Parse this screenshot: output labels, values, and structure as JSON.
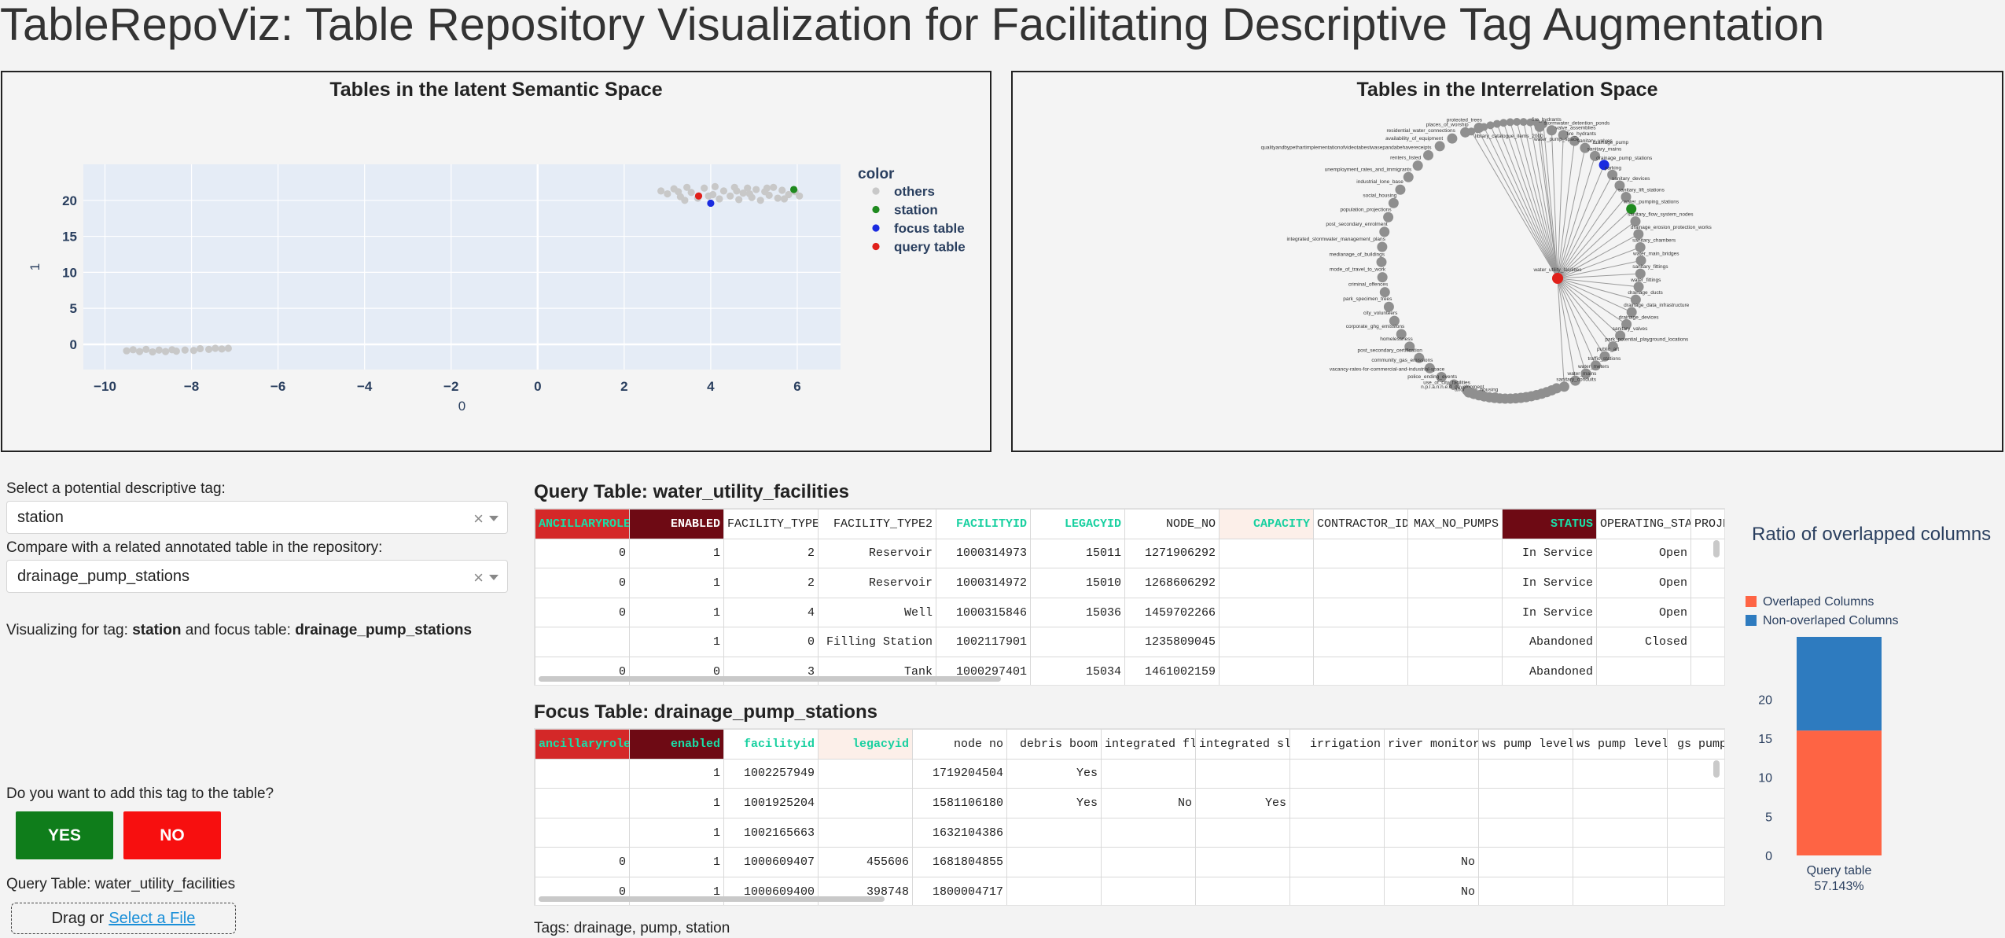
{
  "app": {
    "title": "TableRepoViz: Table Repository Visualization for Facilitating Descriptive Tag Augmentation"
  },
  "semantic_panel": {
    "title": "Tables in the latent Semantic Space",
    "chart_data": {
      "type": "scatter",
      "title": "Tables in the latent Semantic Space",
      "xlabel": "0",
      "ylabel": "1",
      "xlim": [
        -10.5,
        7
      ],
      "ylim": [
        -3.5,
        25
      ],
      "xticks": [
        -10,
        -8,
        -6,
        -4,
        -2,
        0,
        2,
        4,
        6
      ],
      "yticks": [
        0,
        5,
        10,
        15,
        20
      ],
      "grid": true,
      "legend_title": "color",
      "legend_placement": "right",
      "series": [
        {
          "name": "others",
          "color": "#c8c8c8",
          "points": [
            [
              -9.5,
              -0.9
            ],
            [
              -9.35,
              -0.75
            ],
            [
              -9.2,
              -1.0
            ],
            [
              -9.05,
              -0.7
            ],
            [
              -8.9,
              -1.05
            ],
            [
              -8.75,
              -0.8
            ],
            [
              -8.6,
              -1.0
            ],
            [
              -8.45,
              -0.75
            ],
            [
              -8.35,
              -0.95
            ],
            [
              -8.15,
              -0.8
            ],
            [
              -7.95,
              -0.85
            ],
            [
              -7.8,
              -0.6
            ],
            [
              -7.6,
              -0.7
            ],
            [
              -7.45,
              -0.55
            ],
            [
              -7.3,
              -0.65
            ],
            [
              -7.15,
              -0.55
            ],
            [
              2.85,
              21.3
            ],
            [
              3.0,
              20.9
            ],
            [
              3.15,
              21.6
            ],
            [
              3.3,
              20.5
            ],
            [
              3.45,
              21.8
            ],
            [
              3.55,
              21.1
            ],
            [
              3.7,
              20.3
            ],
            [
              3.85,
              21.7
            ],
            [
              3.95,
              20.6
            ],
            [
              4.1,
              21.9
            ],
            [
              4.2,
              20.2
            ],
            [
              4.3,
              21.3
            ],
            [
              4.45,
              20.6
            ],
            [
              4.55,
              21.8
            ],
            [
              4.65,
              20.1
            ],
            [
              4.75,
              21.0
            ],
            [
              4.85,
              21.7
            ],
            [
              4.95,
              20.4
            ],
            [
              5.05,
              21.5
            ],
            [
              5.15,
              20.0
            ],
            [
              5.25,
              21.2
            ],
            [
              5.35,
              20.7
            ],
            [
              5.45,
              21.8
            ],
            [
              5.55,
              20.3
            ],
            [
              5.65,
              21.4
            ],
            [
              5.8,
              20.8
            ],
            [
              5.95,
              21.2
            ],
            [
              3.4,
              20.0
            ],
            [
              4.05,
              20.8
            ],
            [
              4.9,
              20.9
            ],
            [
              5.3,
              21.7
            ],
            [
              3.25,
              21.2
            ],
            [
              4.6,
              21.3
            ],
            [
              5.7,
              20.2
            ],
            [
              6.05,
              20.6
            ]
          ]
        },
        {
          "name": "station",
          "color": "#1f8a1f",
          "points": [
            [
              5.92,
              21.5
            ]
          ]
        },
        {
          "name": "focus table",
          "color": "#1a2be0",
          "points": [
            [
              4.0,
              19.6
            ]
          ]
        },
        {
          "name": "query table",
          "color": "#e0201a",
          "points": [
            [
              3.72,
              20.6
            ]
          ]
        }
      ]
    }
  },
  "interrelation_panel": {
    "title": "Tables in the Interrelation Space",
    "labels_left": [
      "protected_trees",
      "places_of_worship",
      "residential_water_connections",
      "availability_of_equipment",
      "qualityandbypethartimplementationofvideotabestwasepandabehavereceipts",
      "renters_listed",
      "unemployment_rates_and_immigrants",
      "industrial_lone_base",
      "social_housing",
      "population_projections",
      "post_secondary_enrolment",
      "integrated_stormwater_management_plans",
      "medianage_of_buildings",
      "mode_of_travel_to_work",
      "criminal_offences",
      "park_specimen_trees",
      "city_volunteers",
      "corporate_ghg_emissions",
      "homelessness",
      "post_secondary_certification",
      "community_gas_emissions",
      "vacancy-rates-for-commercial-and-industrial-space",
      "police_ending_events",
      "use_of_city_facilities",
      "n.p.l.a.n.n.e.d_development",
      "affordable_housing"
    ],
    "labels_right": [
      "fire_hydrants",
      "stormwater_detention_ponds",
      "valve_assemblies",
      "fire_hydrants",
      "sanitary_valves",
      "sanitary_mains",
      "drainage_pump_stations",
      "parking",
      "sanitary_devices",
      "sanitary_lift_stations",
      "water_pumping_stations",
      "sanitary_flow_system_nodes",
      "drainage_erosion_protection_works",
      "sanitary_chambers",
      "water_main_bridges",
      "sanitary_fittings",
      "water_fittings",
      "drainage_ducts",
      "drainage_data_infrastructure",
      "drainage_devices",
      "sanitary_valves",
      "park_potential_playground_locations",
      "public_art",
      "traffic_stations",
      "water_meters",
      "water_mains",
      "sanitary_conduits"
    ],
    "labels_top": [
      "library_catalogue_items_2000",
      "water_pump_space",
      "drainage_pump"
    ],
    "query_label": "water_utility_facilities"
  },
  "controls": {
    "tag_prompt": "Select a potential descriptive tag:",
    "tag_value": "station",
    "compare_prompt": "Compare with a related annotated table in the repository:",
    "compare_value": "drainage_pump_stations",
    "clear_symbol": "×",
    "status_prefix": "Visualizing for tag: ",
    "status_tag": "station",
    "status_middle": " and focus table: ",
    "status_table": "drainage_pump_stations",
    "add_prompt": "Do you want to add this tag to the table?",
    "yes_label": "YES",
    "no_label": "NO",
    "query_table_line": "Query Table: water_utility_facilities",
    "upload_text": "Drag or",
    "upload_link": "Select a File",
    "colors": {
      "yes": "#0f7d1b",
      "no": "#f70f0f"
    }
  },
  "query_table": {
    "title": "Query Table: water_utility_facilities",
    "columns": [
      {
        "name": "ANCILLARYROLE",
        "bg": "#d42828",
        "fg": "#18e0a8",
        "cell": "#ffffff"
      },
      {
        "name": "ENABLED",
        "bg": "#6e0a14",
        "fg": "#ffffff",
        "cell": "#ffffff"
      },
      {
        "name": "FACILITY_TYPE",
        "bg": "#ffffff",
        "fg": "#222222",
        "cell": "#ffffff"
      },
      {
        "name": "FACILITY_TYPE2",
        "bg": "#ffffff",
        "fg": "#222222",
        "cell": "#ffffff"
      },
      {
        "name": "FACILITYID",
        "bg": "#ffffff",
        "fg": "#18d0a0",
        "cell": "#ffffff"
      },
      {
        "name": "LEGACYID",
        "bg": "#ffffff",
        "fg": "#18d0a0",
        "cell": "#ffffff"
      },
      {
        "name": "NODE_NO",
        "bg": "#ffffff",
        "fg": "#222222",
        "cell": "#ffffff"
      },
      {
        "name": "CAPACITY",
        "bg": "#fcefe9",
        "fg": "#18d0a0",
        "cell": "#ffffff"
      },
      {
        "name": "CONTRACTOR_ID",
        "bg": "#ffffff",
        "fg": "#222222",
        "cell": "#ffffff"
      },
      {
        "name": "MAX_NO_PUMPS",
        "bg": "#ffffff",
        "fg": "#222222",
        "cell": "#ffffff"
      },
      {
        "name": "STATUS",
        "bg": "#6e0a14",
        "fg": "#18e0a8",
        "cell": "#ffffff"
      },
      {
        "name": "OPERATING_STATUS",
        "bg": "#ffffff",
        "fg": "#222222",
        "cell": "#ffffff"
      },
      {
        "name": "PROJECT",
        "bg": "#ffffff",
        "fg": "#222222",
        "cell": "#ffffff"
      }
    ],
    "rows": [
      [
        "0",
        "1",
        "2",
        "Reservoir",
        "1000314973",
        "15011",
        "1271906292",
        "",
        "",
        "",
        "In Service",
        "Open",
        ""
      ],
      [
        "0",
        "1",
        "2",
        "Reservoir",
        "1000314972",
        "15010",
        "1268606292",
        "",
        "",
        "",
        "In Service",
        "Open",
        ""
      ],
      [
        "0",
        "1",
        "4",
        "Well",
        "1000315846",
        "15036",
        "1459702266",
        "",
        "",
        "",
        "In Service",
        "Open",
        ""
      ],
      [
        "",
        "1",
        "0",
        "Filling Station",
        "1002117901",
        "",
        "1235809045",
        "",
        "",
        "",
        "Abandoned",
        "Closed",
        ""
      ],
      [
        "0",
        "0",
        "3",
        "Tank",
        "1000297401",
        "15034",
        "1461002159",
        "",
        "",
        "",
        "Abandoned",
        "",
        ""
      ]
    ]
  },
  "focus_table": {
    "title": "Focus Table: drainage_pump_stations",
    "columns": [
      {
        "name": "ancillaryrole",
        "bg": "#d42828",
        "fg": "#18e0a8"
      },
      {
        "name": "enabled",
        "bg": "#6e0a14",
        "fg": "#18e0a8"
      },
      {
        "name": "facilityid",
        "bg": "#ffffff",
        "fg": "#18d0a0"
      },
      {
        "name": "legacyid",
        "bg": "#fcefe9",
        "fg": "#18d0a0"
      },
      {
        "name": "node no",
        "bg": "#ffffff",
        "fg": "#222222"
      },
      {
        "name": "debris boom",
        "bg": "#ffffff",
        "fg": "#222222"
      },
      {
        "name": "integrated flow",
        "bg": "#ffffff",
        "fg": "#222222"
      },
      {
        "name": "integrated sluice",
        "bg": "#ffffff",
        "fg": "#222222"
      },
      {
        "name": "irrigation",
        "bg": "#ffffff",
        "fg": "#222222"
      },
      {
        "name": "river monitor",
        "bg": "#ffffff",
        "fg": "#222222"
      },
      {
        "name": "ws pump level",
        "bg": "#ffffff",
        "fg": "#222222"
      },
      {
        "name": "ws pump level",
        "bg": "#ffffff",
        "fg": "#222222"
      },
      {
        "name": "gs pump",
        "bg": "#ffffff",
        "fg": "#222222"
      }
    ],
    "rows": [
      [
        "",
        "1",
        "1002257949",
        "",
        "1719204504",
        "Yes",
        "",
        "",
        "",
        "",
        "",
        "",
        ""
      ],
      [
        "",
        "1",
        "1001925204",
        "",
        "1581106180",
        "Yes",
        "No",
        "Yes",
        "",
        "",
        "",
        "",
        ""
      ],
      [
        "",
        "1",
        "1002165663",
        "",
        "1632104386",
        "",
        "",
        "",
        "",
        "",
        "",
        "",
        ""
      ],
      [
        "0",
        "1",
        "1000609407",
        "455606",
        "1681804855",
        "",
        "",
        "",
        "",
        "No",
        "",
        "",
        ""
      ],
      [
        "0",
        "1",
        "1000609400",
        "398748",
        "1800004717",
        "",
        "",
        "",
        "",
        "No",
        "",
        "",
        ""
      ]
    ],
    "tags_line": "Tags: drainage, pump, station"
  },
  "ratio_chart": {
    "title": "Ratio of overlapped columns",
    "chart_data": {
      "type": "bar",
      "title": "Ratio of overlapped columns",
      "categories": [
        "Query table"
      ],
      "category_sublabel": "57.143%",
      "stacked": true,
      "ylim": [
        0,
        28
      ],
      "yticks": [
        0,
        5,
        10,
        15,
        20
      ],
      "legend_placement": "top",
      "series": [
        {
          "name": "Overlaped Columns",
          "color": "#fe6444",
          "values": [
            16
          ]
        },
        {
          "name": "Non-overlaped Columns",
          "color": "#2e7bbf",
          "values": [
            12
          ]
        }
      ]
    }
  }
}
